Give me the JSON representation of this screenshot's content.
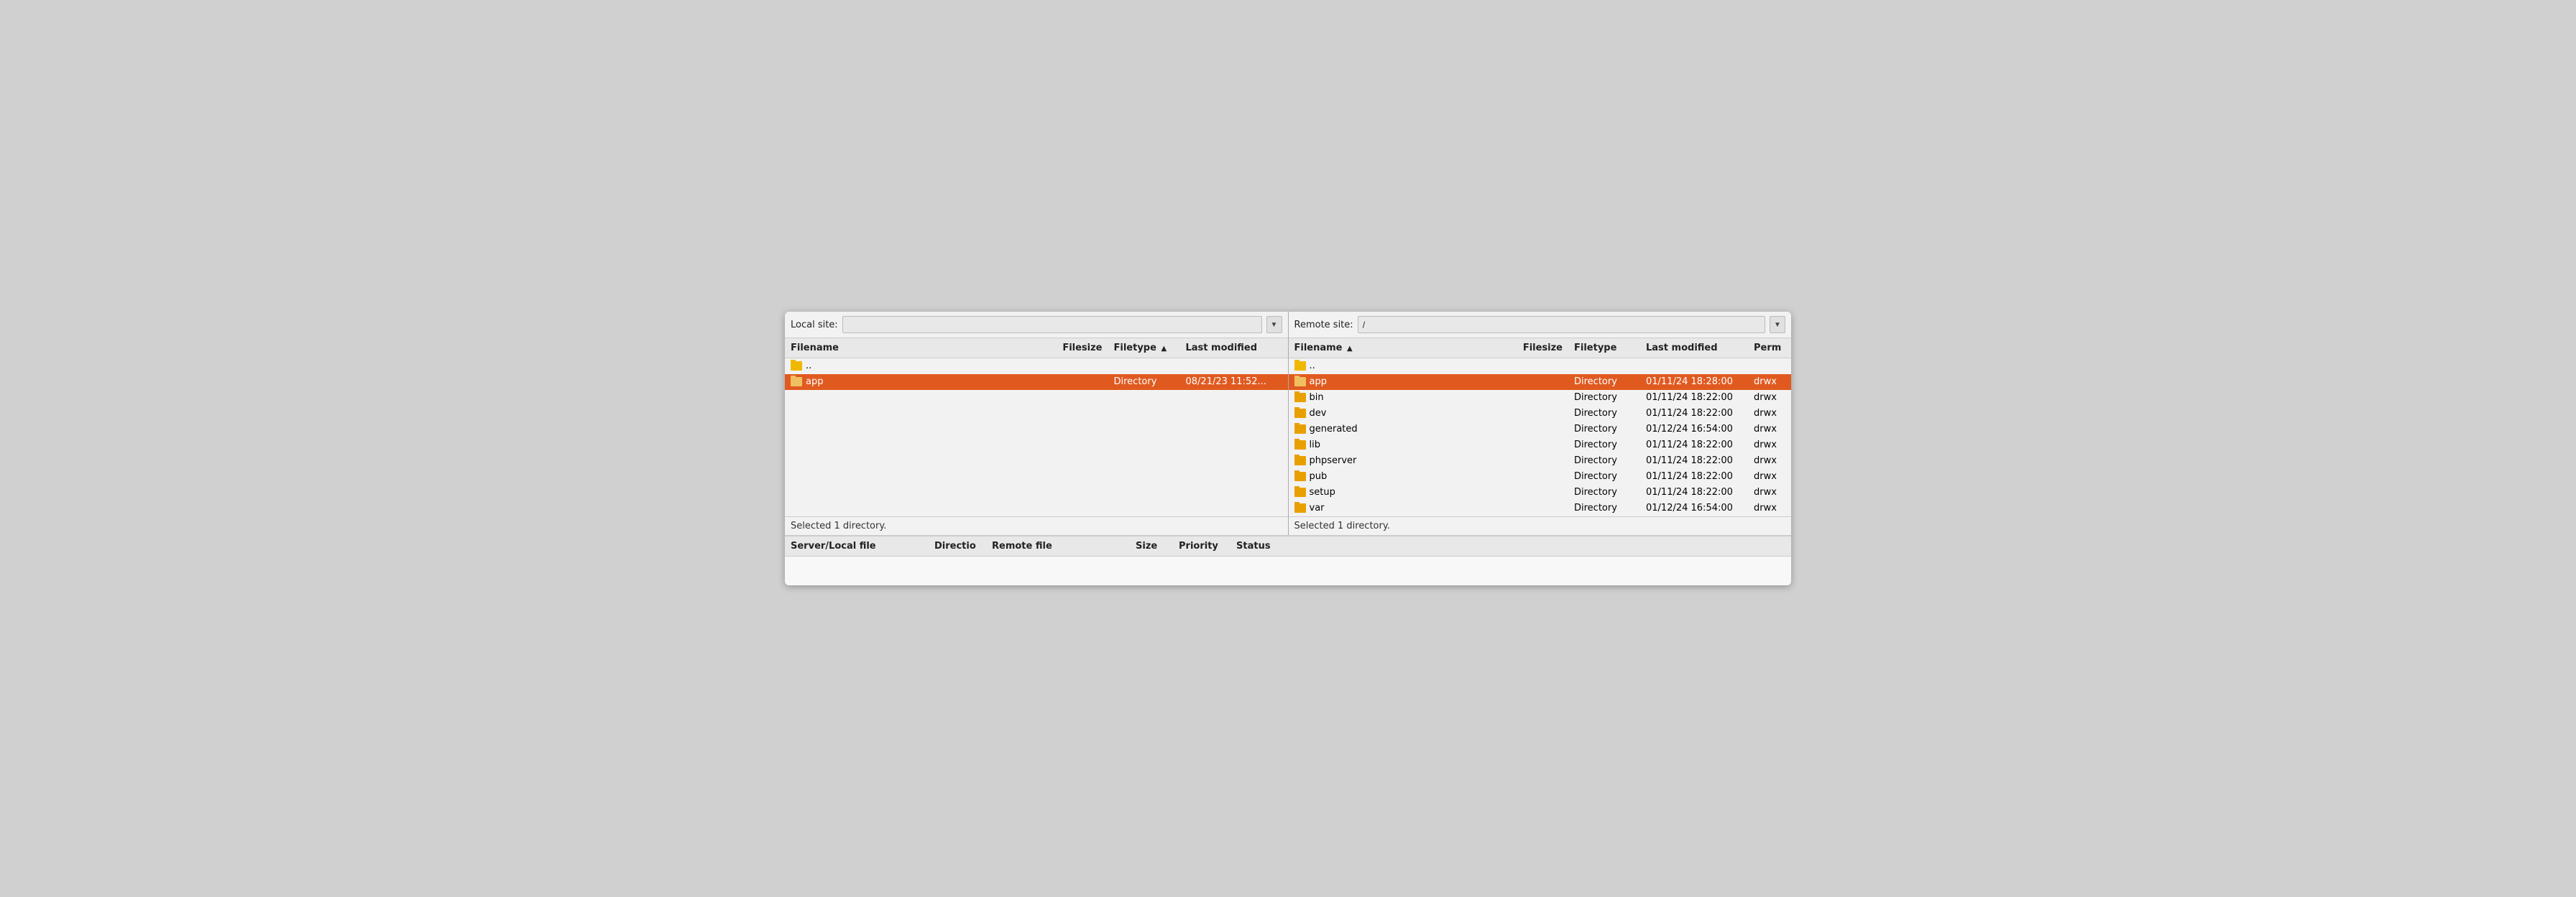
{
  "local_panel": {
    "site_label": "Local site:",
    "site_path": "",
    "site_placeholder": "",
    "columns": {
      "filename": "Filename",
      "filesize": "Filesize",
      "filetype": "Filetype",
      "filetype_sort": "▲",
      "lastmodified": "Last modified"
    },
    "rows": [
      {
        "name": "..",
        "filesize": "",
        "filetype": "",
        "lastmodified": "",
        "is_parent": true,
        "selected": false
      },
      {
        "name": "app",
        "filesize": "",
        "filetype": "Directory",
        "lastmodified": "08/21/23 11:52...",
        "is_parent": false,
        "selected": true
      }
    ],
    "status": "Selected 1 directory."
  },
  "remote_panel": {
    "site_label": "Remote site:",
    "site_path": "/",
    "site_placeholder": "/",
    "columns": {
      "filename": "Filename",
      "filename_sort": "▲",
      "filesize": "Filesize",
      "filetype": "Filetype",
      "lastmodified": "Last modified",
      "permissions": "Perm"
    },
    "rows": [
      {
        "name": "..",
        "filesize": "",
        "filetype": "",
        "lastmodified": "",
        "permissions": "",
        "is_parent": true,
        "selected": false
      },
      {
        "name": "app",
        "filesize": "",
        "filetype": "Directory",
        "lastmodified": "01/11/24 18:28:00",
        "permissions": "drwx",
        "is_parent": false,
        "selected": true
      },
      {
        "name": "bin",
        "filesize": "",
        "filetype": "Directory",
        "lastmodified": "01/11/24 18:22:00",
        "permissions": "drwx",
        "is_parent": false,
        "selected": false
      },
      {
        "name": "dev",
        "filesize": "",
        "filetype": "Directory",
        "lastmodified": "01/11/24 18:22:00",
        "permissions": "drwx",
        "is_parent": false,
        "selected": false
      },
      {
        "name": "generated",
        "filesize": "",
        "filetype": "Directory",
        "lastmodified": "01/12/24 16:54:00",
        "permissions": "drwx",
        "is_parent": false,
        "selected": false
      },
      {
        "name": "lib",
        "filesize": "",
        "filetype": "Directory",
        "lastmodified": "01/11/24 18:22:00",
        "permissions": "drwx",
        "is_parent": false,
        "selected": false
      },
      {
        "name": "phpserver",
        "filesize": "",
        "filetype": "Directory",
        "lastmodified": "01/11/24 18:22:00",
        "permissions": "drwx",
        "is_parent": false,
        "selected": false
      },
      {
        "name": "pub",
        "filesize": "",
        "filetype": "Directory",
        "lastmodified": "01/11/24 18:22:00",
        "permissions": "drwx",
        "is_parent": false,
        "selected": false
      },
      {
        "name": "setup",
        "filesize": "",
        "filetype": "Directory",
        "lastmodified": "01/11/24 18:22:00",
        "permissions": "drwx",
        "is_parent": false,
        "selected": false
      },
      {
        "name": "var",
        "filesize": "",
        "filetype": "Directory",
        "lastmodified": "01/12/24 16:54:00",
        "permissions": "drwx",
        "is_parent": false,
        "selected": false
      }
    ],
    "status": "Selected 1 directory."
  },
  "transfer_queue": {
    "columns": {
      "server_local": "Server/Local file",
      "direction": "Directio",
      "remote_file": "Remote file",
      "size": "Size",
      "priority": "Priority",
      "status": "Status"
    }
  },
  "icons": {
    "dropdown": "▼",
    "sort_asc": "▲",
    "folder": "📁"
  }
}
